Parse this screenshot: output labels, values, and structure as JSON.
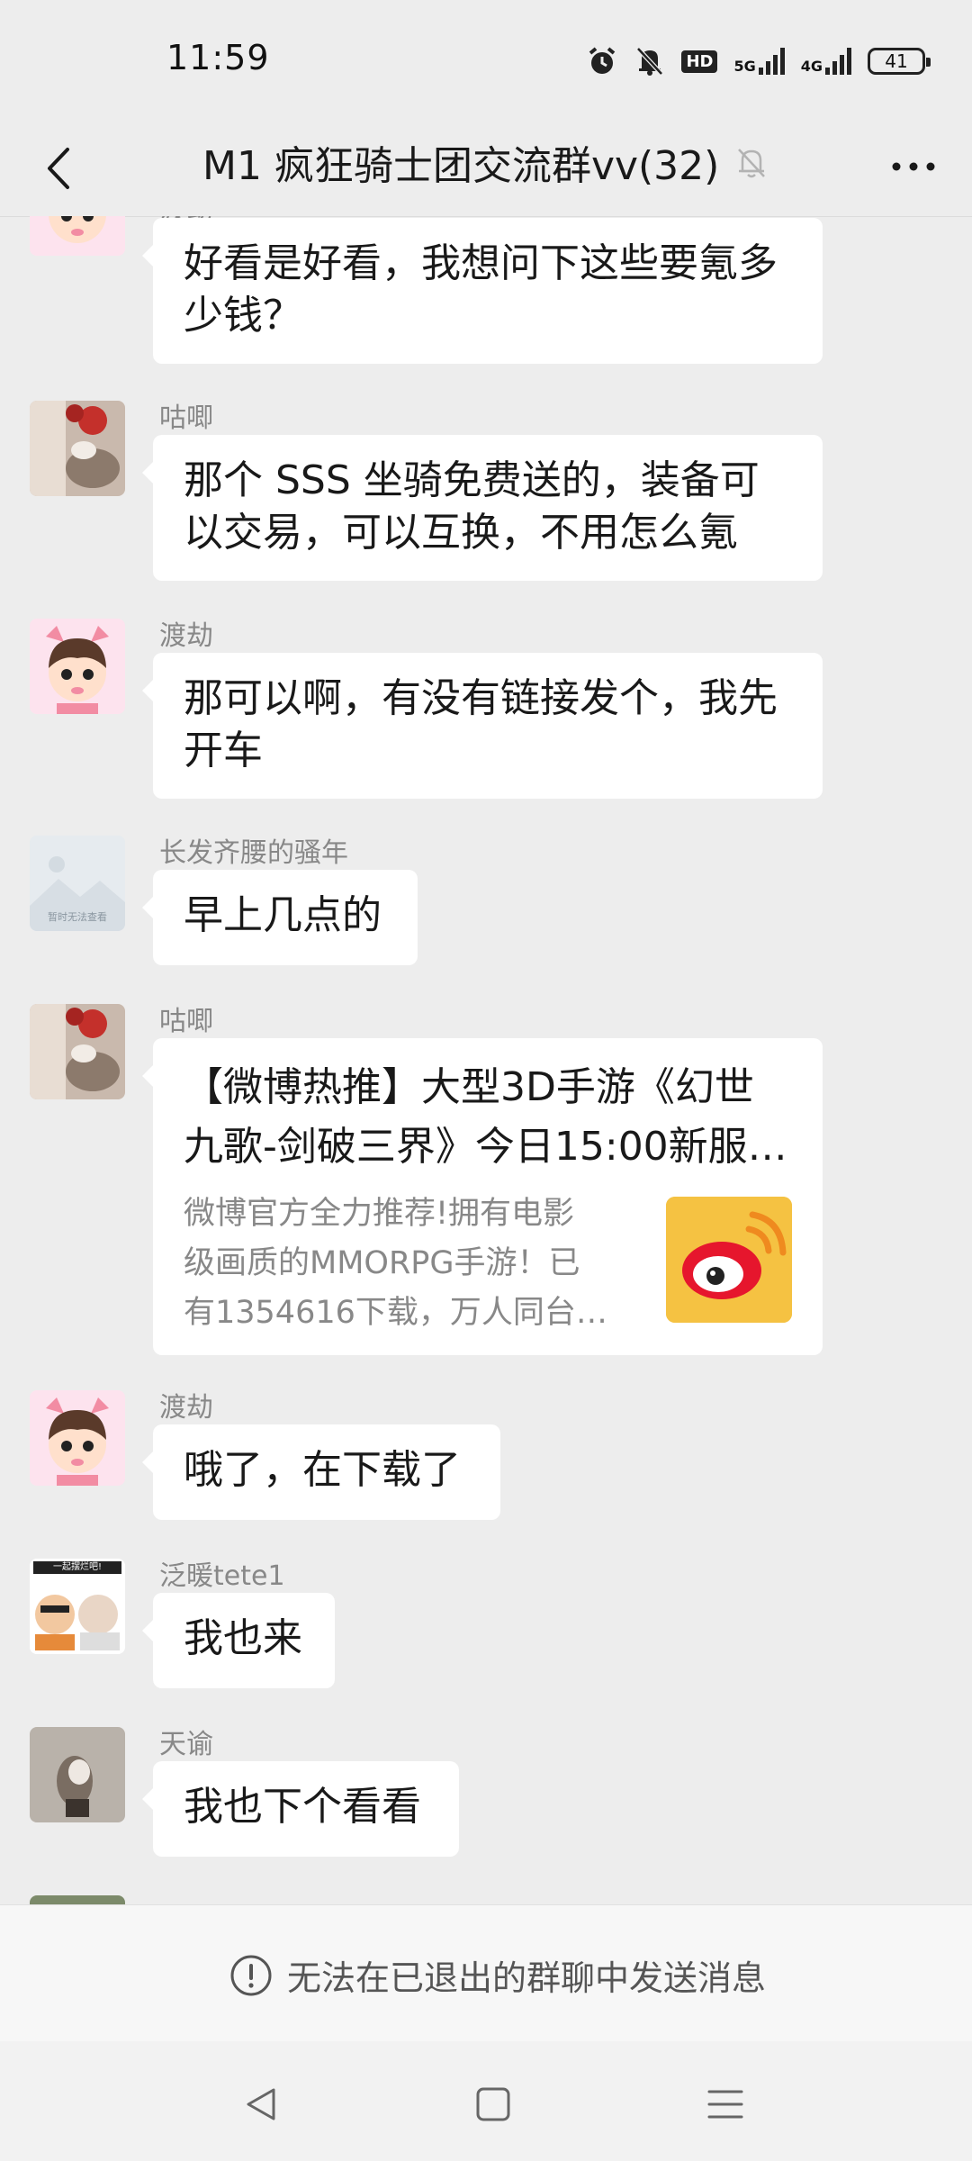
{
  "status_bar": {
    "time": "11:59",
    "net1": "5G",
    "net2": "4G",
    "hd": "HD",
    "battery": "41"
  },
  "header": {
    "title": "M1 疯狂骑士团交流群vv(32)"
  },
  "messages": [
    {
      "sender": "渡劫",
      "text_lines": [
        "好看是好看，我想问下这些要氪多",
        "少钱？"
      ]
    },
    {
      "sender": "咕唧",
      "text_lines": [
        "那个 SSS 坐骑免费送的，装备可",
        "以交易，可以互换，不用怎么氪"
      ]
    },
    {
      "sender": "渡劫",
      "text_lines": [
        "那可以啊，有没有链接发个，我先",
        "开车"
      ]
    },
    {
      "sender": "长发齐腰的骚年",
      "text": "早上几点的",
      "avatar_caption": "暂时无法查看"
    },
    {
      "sender": "咕唧",
      "card": {
        "title_lines": [
          "【微博热推】大型3D手游《幻世",
          "九歌-剑破三界》今日15:00新服…"
        ],
        "desc_lines": [
          "微博官方全力推荐!拥有电影",
          "级画质的MMORPG手游！已",
          "有1354616下载，万人同台…"
        ],
        "thumb_icon": "weibo-logo-icon"
      }
    },
    {
      "sender": "渡劫",
      "text": "哦了，在下载了"
    },
    {
      "sender": "泛暖tete1",
      "text": "我也来",
      "avatar_caption": "一起摆烂吧!"
    },
    {
      "sender": "天谕",
      "text": "我也下个看看"
    }
  ],
  "notice": {
    "text": "无法在已退出的群聊中发送消息",
    "icon": "exclamation-circle-icon"
  },
  "colors": {
    "background": "#ededed",
    "bubble": "#ffffff",
    "sender_text": "#888888"
  }
}
